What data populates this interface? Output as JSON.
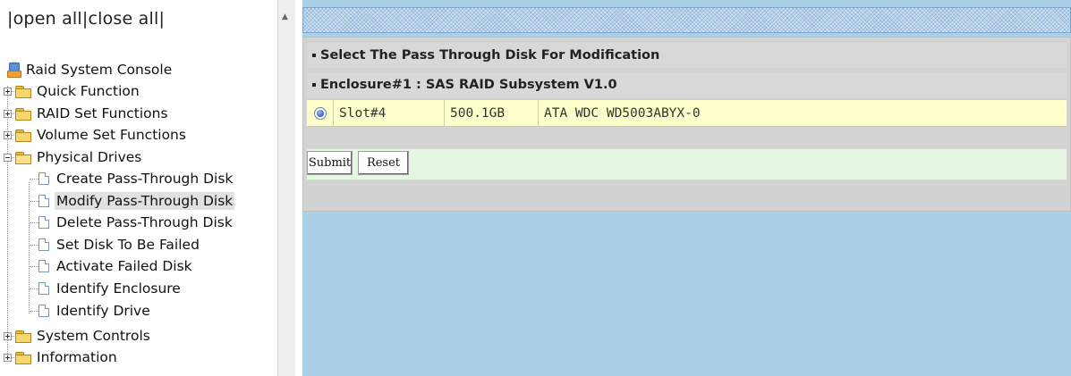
{
  "left_pane": {
    "open_all": "open all",
    "close_all": "close all",
    "sep_left": "|",
    "sep_mid": "|",
    "sep_right": "|",
    "tree": {
      "root": "Raid System Console",
      "quick_function": "Quick Function",
      "raid_set_functions": "RAID Set Functions",
      "volume_set_functions": "Volume Set Functions",
      "physical_drives": "Physical Drives",
      "physical_children": [
        "Create Pass-Through Disk",
        "Modify Pass-Through Disk",
        "Delete Pass-Through Disk",
        "Set Disk To Be Failed",
        "Activate Failed Disk",
        "Identify Enclosure",
        "Identify Drive"
      ],
      "system_controls": "System Controls",
      "information": "Information",
      "selected_item": "Modify Pass-Through Disk"
    }
  },
  "main": {
    "header_title": "Select The Pass Through Disk For Modification",
    "enclosure_title": "Enclosure#1 : SAS RAID Subsystem V1.0",
    "drive": {
      "selected": true,
      "slot": "Slot#4",
      "capacity": "500.1GB",
      "model": "ATA WDC WD5003ABYX-0"
    },
    "submit_label": "Submit",
    "reset_label": "Reset"
  },
  "colors": {
    "content_bg": "#aad0e7",
    "drive_row_bg": "#ffffcc",
    "button_row_bg": "#e6f7e1",
    "panel_bg": "#d3d3d3"
  }
}
